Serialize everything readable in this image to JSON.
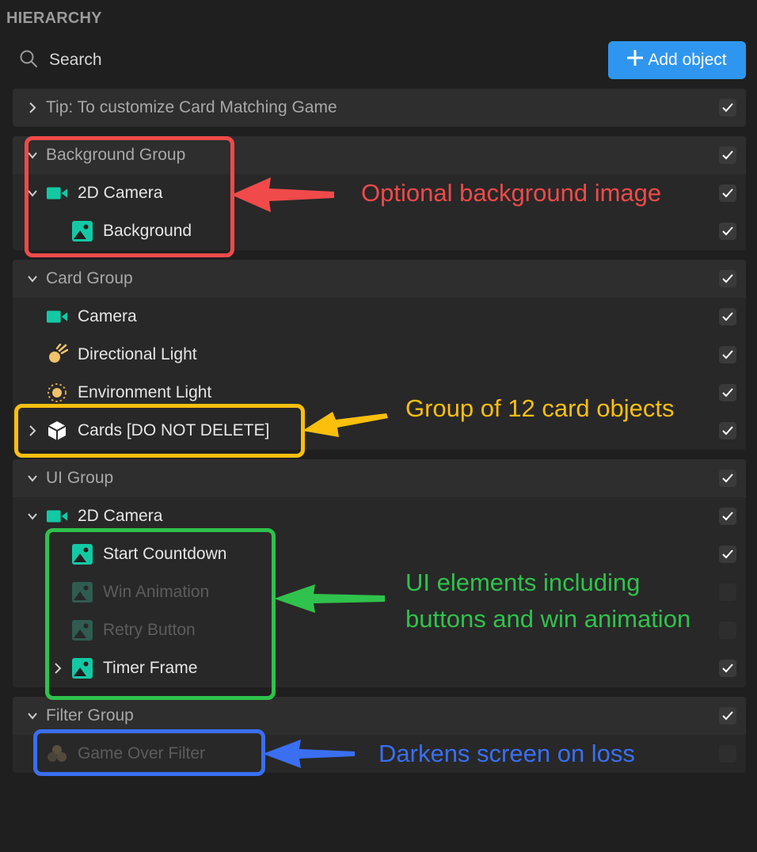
{
  "header": {
    "title": "HIERARCHY"
  },
  "search": {
    "placeholder": "Search"
  },
  "toolbar": {
    "add_label": "Add object"
  },
  "tip": {
    "label": "Tip: To customize Card Matching Game"
  },
  "background_group": {
    "label": "Background Group",
    "items": [
      {
        "label": "2D Camera",
        "icon": "camera-icon"
      },
      {
        "label": "Background",
        "icon": "image-icon"
      }
    ]
  },
  "card_group": {
    "label": "Card Group",
    "items": [
      {
        "label": "Camera",
        "icon": "camera-icon"
      },
      {
        "label": "Directional Light",
        "icon": "directional-light-icon"
      },
      {
        "label": "Environment Light",
        "icon": "environment-light-icon"
      },
      {
        "label": "Cards [DO NOT DELETE]",
        "icon": "cube-icon"
      }
    ]
  },
  "ui_group": {
    "label": "UI Group",
    "items": [
      {
        "label": "2D Camera",
        "icon": "camera-icon"
      },
      {
        "label": "Start Countdown",
        "icon": "image-icon"
      },
      {
        "label": "Win Animation",
        "icon": "image-icon",
        "enabled": false
      },
      {
        "label": "Retry Button",
        "icon": "image-icon",
        "enabled": false
      },
      {
        "label": "Timer Frame",
        "icon": "image-icon"
      }
    ]
  },
  "filter_group": {
    "label": "Filter Group",
    "items": [
      {
        "label": "Game Over Filter",
        "icon": "filter-icon",
        "enabled": false
      }
    ]
  },
  "annotations": {
    "background": "Optional background image",
    "cards": "Group of 12 card objects",
    "ui_line1": "UI elements including",
    "ui_line2": "buttons and win animation",
    "filter": "Darkens screen on loss"
  },
  "colors": {
    "accent": "#2f96ef",
    "teal_icon": "#12c9a4",
    "red": "#f04a4a",
    "yellow": "#fbbf0c",
    "green": "#2fc24c",
    "blue": "#3a6ff2"
  }
}
